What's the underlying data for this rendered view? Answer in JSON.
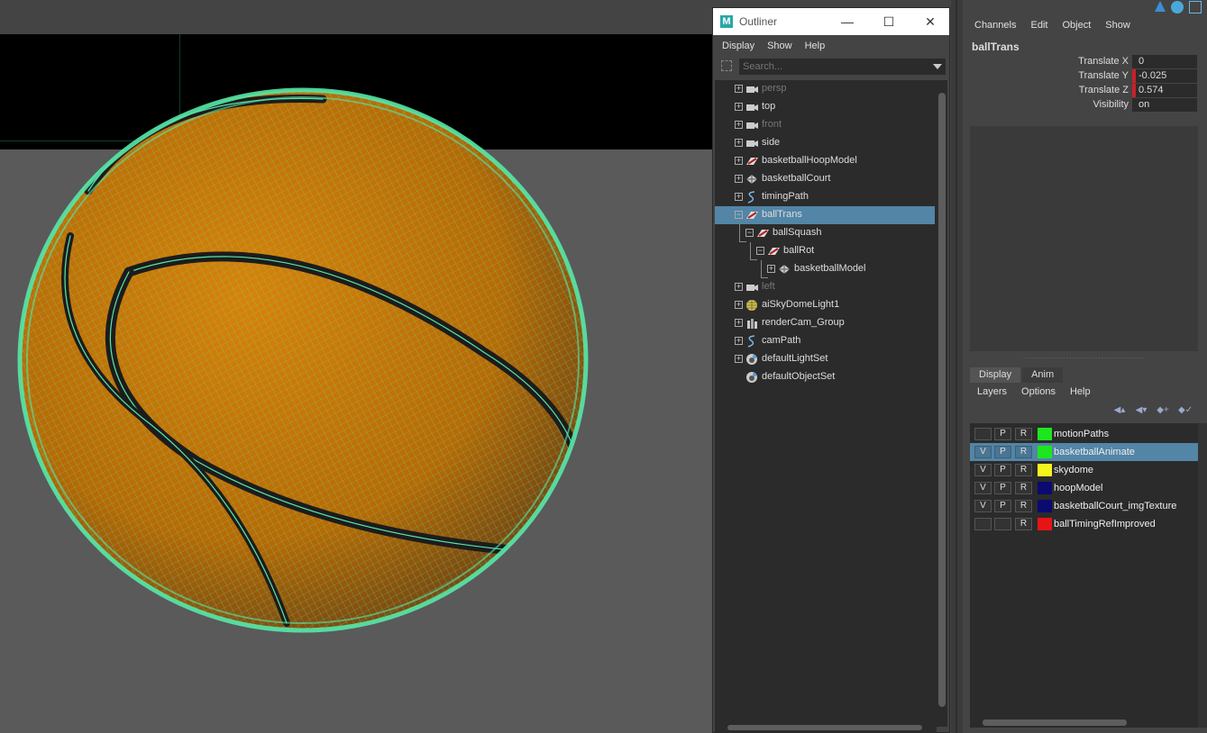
{
  "outliner": {
    "window_title": "Outliner",
    "logo": "M",
    "window_buttons": {
      "minimize": "—",
      "maximize": "☐",
      "close": "✕"
    },
    "menu": [
      "Display",
      "Show",
      "Help"
    ],
    "search_placeholder": "Search...",
    "items": [
      {
        "label": "persp",
        "icon": "camera-icon",
        "dim": true,
        "expander": "+"
      },
      {
        "label": "top",
        "icon": "camera-icon",
        "dim": false,
        "expander": "+"
      },
      {
        "label": "front",
        "icon": "camera-icon",
        "dim": true,
        "expander": "+"
      },
      {
        "label": "side",
        "icon": "camera-icon",
        "dim": false,
        "expander": "+"
      },
      {
        "label": "basketballHoopModel",
        "icon": "transform-icon",
        "dim": false,
        "expander": "+"
      },
      {
        "label": "basketballCourt",
        "icon": "mesh-icon",
        "dim": false,
        "expander": "+"
      },
      {
        "label": "timingPath",
        "icon": "curve-icon",
        "dim": false,
        "expander": "+"
      },
      {
        "label": "ballTrans",
        "icon": "transform-icon",
        "dim": false,
        "expander": "−",
        "selected": true
      },
      {
        "label": "ballSquash",
        "icon": "transform-icon",
        "dim": false,
        "expander": "−"
      },
      {
        "label": "ballRot",
        "icon": "transform-icon",
        "dim": false,
        "expander": "−"
      },
      {
        "label": "basketballModel",
        "icon": "mesh-icon",
        "dim": false,
        "expander": "+"
      },
      {
        "label": "left",
        "icon": "camera-icon",
        "dim": true,
        "expander": "+"
      },
      {
        "label": "aiSkyDomeLight1",
        "icon": "skydome-icon",
        "dim": false,
        "expander": "+"
      },
      {
        "label": "renderCam_Group",
        "icon": "group-icon",
        "dim": false,
        "expander": "+"
      },
      {
        "label": "camPath",
        "icon": "curve-icon",
        "dim": false,
        "expander": "+"
      },
      {
        "label": "defaultLightSet",
        "icon": "set-icon",
        "dim": false,
        "expander": "+"
      },
      {
        "label": "defaultObjectSet",
        "icon": "set-icon",
        "dim": false,
        "expander": ""
      }
    ]
  },
  "channel_box": {
    "menu": [
      "Channels",
      "Edit",
      "Object",
      "Show"
    ],
    "object_name": "ballTrans",
    "attributes": [
      {
        "name": "Translate X",
        "value": "0",
        "keyed": false
      },
      {
        "name": "Translate Y",
        "value": "-0.025",
        "keyed": true
      },
      {
        "name": "Translate Z",
        "value": "0.574",
        "keyed": true
      },
      {
        "name": "Visibility",
        "value": "on",
        "keyed": false
      }
    ],
    "key_color": "#c8202a"
  },
  "layer_editor": {
    "tabs": [
      "Display",
      "Anim"
    ],
    "menu": [
      "Layers",
      "Options",
      "Help"
    ],
    "layers": [
      {
        "v": "",
        "p": "P",
        "r": "R",
        "color": "#1ee61e",
        "name": "motionPaths",
        "selected": false
      },
      {
        "v": "V",
        "p": "P",
        "r": "R",
        "color": "#1ee61e",
        "name": "basketballAnimate",
        "selected": true
      },
      {
        "v": "V",
        "p": "P",
        "r": "R",
        "color": "#f5f51e",
        "name": "skydome",
        "selected": false
      },
      {
        "v": "V",
        "p": "P",
        "r": "R",
        "color": "#0a0a70",
        "name": "hoopModel",
        "selected": false
      },
      {
        "v": "V",
        "p": "P",
        "r": "R",
        "color": "#0a0a70",
        "name": "basketballCourt_imgTexture",
        "selected": false
      },
      {
        "v": "",
        "p": "",
        "r": "R",
        "color": "#e61414",
        "name": "ballTimingRefImproved",
        "selected": false
      }
    ]
  },
  "viewport": {
    "wire_color": "#55e8a8",
    "ball_color": "#c77405"
  }
}
